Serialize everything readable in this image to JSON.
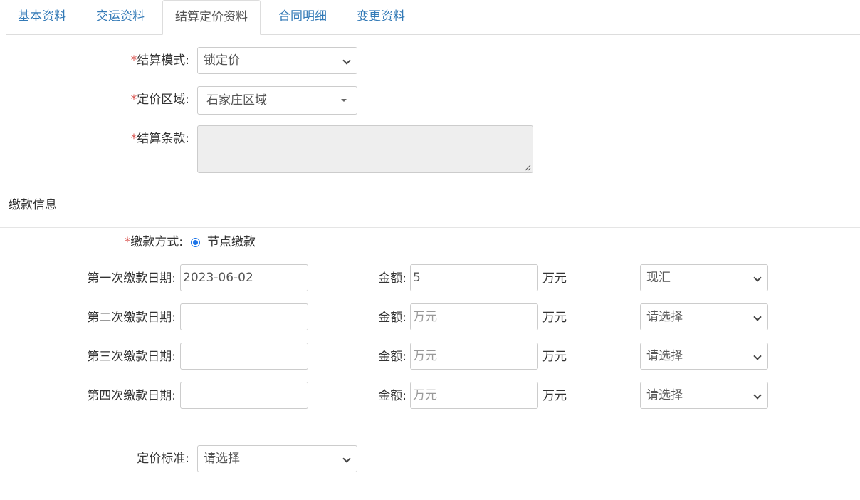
{
  "tabs": [
    "基本资料",
    "交运资料",
    "结算定价资料",
    "合同明细",
    "变更资料"
  ],
  "active_tab": "结算定价资料",
  "settlement": {
    "required_mark": "*",
    "mode_label": "结算模式:",
    "mode_value": "锁定价",
    "region_label": "定价区域:",
    "region_value": "石家庄区域",
    "terms_label": "结算条款:",
    "terms_value": ""
  },
  "payment_section_title": "缴款信息",
  "payment": {
    "method_label": "缴款方式:",
    "method_option": "节点缴款",
    "amount_label": "金额:",
    "unit": "万元",
    "rows": [
      {
        "date_label": "第一次缴款日期:",
        "date_value": "2023-06-02",
        "amount_value": "5",
        "amount_placeholder": "",
        "type_value": "现汇"
      },
      {
        "date_label": "第二次缴款日期:",
        "date_value": "",
        "amount_value": "",
        "amount_placeholder": "万元",
        "type_value": "请选择"
      },
      {
        "date_label": "第三次缴款日期:",
        "date_value": "",
        "amount_value": "",
        "amount_placeholder": "万元",
        "type_value": "请选择"
      },
      {
        "date_label": "第四次缴款日期:",
        "date_value": "",
        "amount_value": "",
        "amount_placeholder": "万元",
        "type_value": "请选择"
      }
    ]
  },
  "pricing": {
    "standard_label": "定价标准:",
    "standard_value": "请选择"
  },
  "colors": {
    "link": "#337ab7",
    "required": "#d9534f",
    "radio": "#1a73e8"
  }
}
